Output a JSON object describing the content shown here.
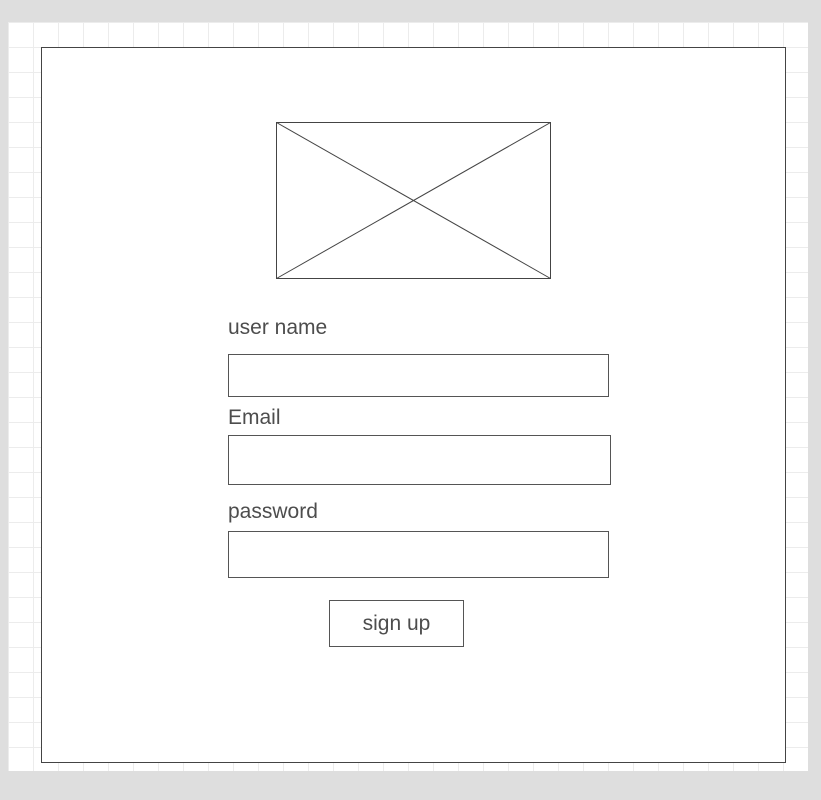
{
  "form": {
    "image_placeholder_icon": "image-placeholder-icon",
    "username": {
      "label": "user name",
      "value": "",
      "placeholder": ""
    },
    "email": {
      "label": "Email",
      "value": "",
      "placeholder": ""
    },
    "password": {
      "label": "password",
      "value": "",
      "placeholder": ""
    },
    "submit_label": "sign up"
  },
  "colors": {
    "page_background": "#dedede",
    "canvas_background": "#ffffff",
    "grid_line": "#ececec",
    "stroke": "#444444",
    "text": "#4d4d4d"
  }
}
